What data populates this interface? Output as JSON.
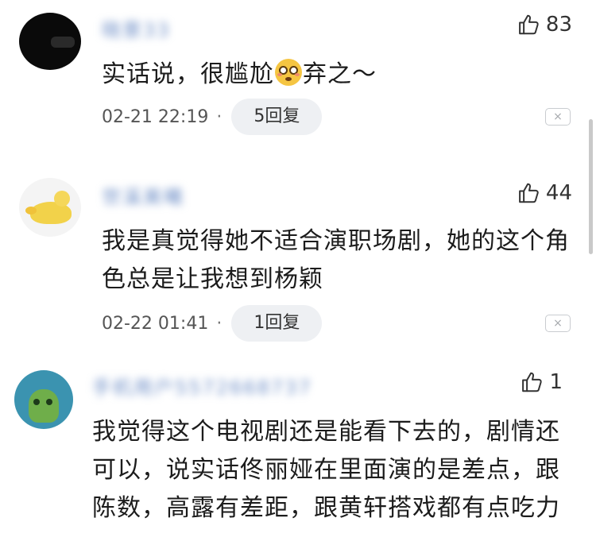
{
  "comments": [
    {
      "username": "晓景33",
      "likes": "83",
      "text": "实话说，很尴尬",
      "text_after_emoji": "弃之～",
      "emoji": "flushed-face-emoji",
      "datetime": "02-21 22:19",
      "separator": "·",
      "replies": "5回复",
      "close": "×"
    },
    {
      "username": "世溪美曦",
      "likes": "44",
      "text": "我是真觉得她不适合演职场剧，她的这个角色总是让我想到杨颖",
      "datetime": "02-22 01:41",
      "separator": "·",
      "replies": "1回复",
      "close": "×"
    },
    {
      "username": "手机用户5572668737",
      "likes": "1",
      "text": "我觉得这个电视剧还是能看下去的，剧情还可以，说实话佟丽娅在里面演的是差点，跟陈数，高露有差距，跟黄轩搭戏都有点吃力"
    }
  ],
  "icons": {
    "like": "thumbs-up-icon",
    "close": "close-icon"
  },
  "colors": {
    "username": "#6f8fc7",
    "pill_bg": "#eef0f3"
  }
}
